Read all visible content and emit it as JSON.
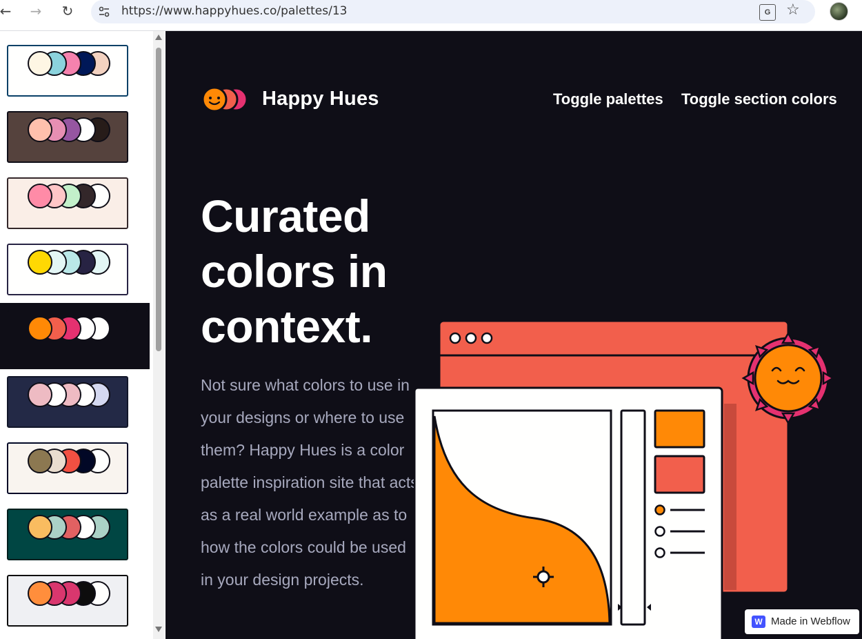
{
  "browser": {
    "back_icon": "←",
    "forward_icon": "→",
    "reload_icon": "↻",
    "url": "https://www.happyhues.co/palettes/13",
    "translate_glyph": "G",
    "star_icon": "☆"
  },
  "sidebar": {
    "palettes": [
      {
        "bg": "#fffffe",
        "border": "#094067",
        "colors": [
          "#fef6e4",
          "#8bd3dd",
          "#f582ae",
          "#001858",
          "#f3d2c1"
        ]
      },
      {
        "bg": "#55423d",
        "border": "#0f0e17",
        "colors": [
          "#ffc0ad",
          "#e78fb3",
          "#9656a1",
          "#fffffe",
          "#271c19"
        ]
      },
      {
        "bg": "#faeee7",
        "border": "#33272a",
        "colors": [
          "#ff8ba7",
          "#ffc6c7",
          "#c3f0ca",
          "#33272a",
          "#fffffe"
        ]
      },
      {
        "bg": "#fffffe",
        "border": "#272343",
        "colors": [
          "#ffd803",
          "#e3f6f5",
          "#bae8e8",
          "#272343",
          "#e3f6f5"
        ]
      },
      {
        "bg": "#0f0e17",
        "border": "#0f0e17",
        "colors": [
          "#ff8906",
          "#f25f4c",
          "#e53170",
          "#fffffe",
          "#fffffe"
        ],
        "active": true
      },
      {
        "bg": "#232946",
        "border": "#121629",
        "colors": [
          "#eebbc3",
          "#fffffe",
          "#eebbc3",
          "#fffffe",
          "#d4d8f0"
        ]
      },
      {
        "bg": "#f9f4ef",
        "border": "#020826",
        "colors": [
          "#8c7851",
          "#eaddcf",
          "#f25042",
          "#020826",
          "#fffffe"
        ]
      },
      {
        "bg": "#004643",
        "border": "#001e1d",
        "colors": [
          "#f9bc60",
          "#abd1c6",
          "#e16162",
          "#fffffe",
          "#abd1c6"
        ]
      },
      {
        "bg": "#eff0f3",
        "border": "#0d0d0d",
        "colors": [
          "#ff8e3c",
          "#d9376e",
          "#d9376e",
          "#0d0d0d",
          "#fffffe"
        ]
      }
    ]
  },
  "header": {
    "brand": "Happy Hues",
    "toggle_palettes": "Toggle palettes",
    "toggle_sections": "Toggle section colors"
  },
  "hero": {
    "headline": "Curated colors in context.",
    "paragraph": "Not sure what colors to use in your designs or where to use them? Happy Hues is a color palette inspiration site that acts as a real world example as to how the colors could be used in your design projects."
  },
  "badge": {
    "logo": "W",
    "text": "Made in Webflow"
  },
  "colors": {
    "background": "#0f0e17",
    "headline": "#fffffe",
    "paragraph": "#a7a9be",
    "button": "#ff8906",
    "secondary": "#f25f4c",
    "tertiary": "#e53170"
  }
}
